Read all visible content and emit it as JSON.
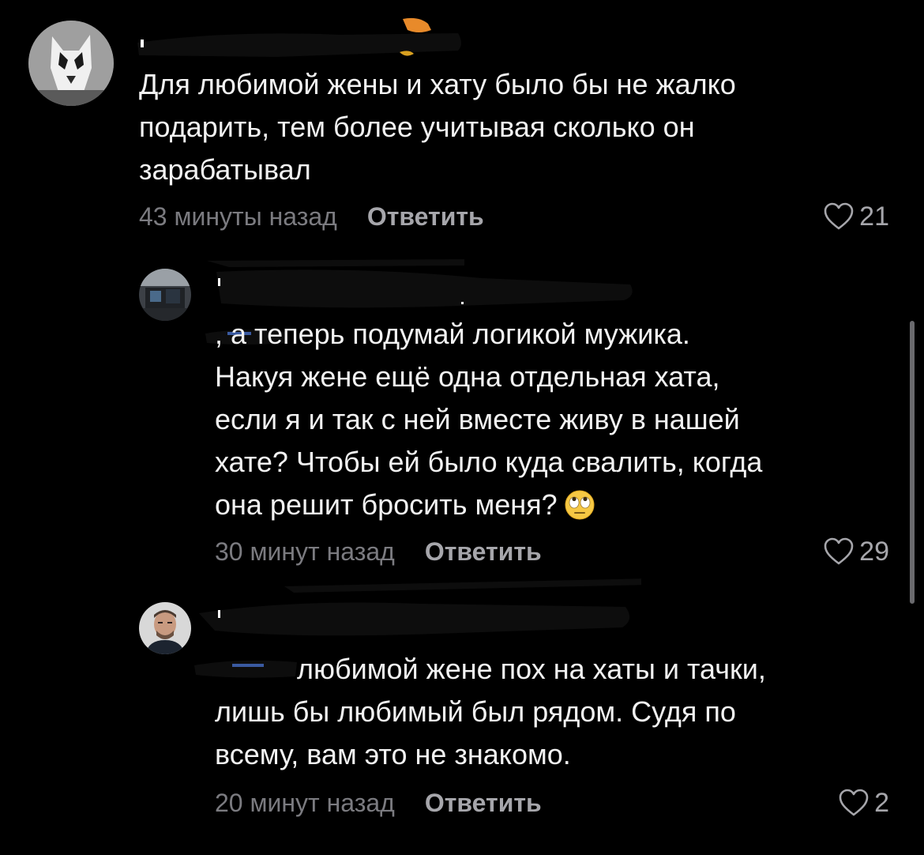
{
  "comments": [
    {
      "text": "Для любимой жены и хату было бы не жалко\nподарить, тем более учитывая сколько он\nзарабатывал",
      "time": "43 минуты назад",
      "reply_label": "Ответить",
      "likes": "21"
    },
    {
      "text": ", а теперь подумай логикой мужика.\nНакуя жене ещё одна отдельная хата,\nесли я и так с ней вместе живу в нашей\nхате? Чтобы ей было куда свалить, когда\nона решит бросить меня?",
      "emoji": "face-with-rolling-eyes",
      "time": "30 минут назад",
      "reply_label": "Ответить",
      "likes": "29"
    },
    {
      "text": " любимой жене пох на хаты и тачки,\nлишь бы любимый был рядом. Судя по\nвсему, вам это не знакомо.",
      "time": "20 минут назад",
      "reply_label": "Ответить",
      "likes": "2"
    }
  ],
  "colors": {
    "background": "#000000",
    "text": "#f2f2f2",
    "meta": "#7b7b80",
    "action": "#a6a6ab"
  }
}
